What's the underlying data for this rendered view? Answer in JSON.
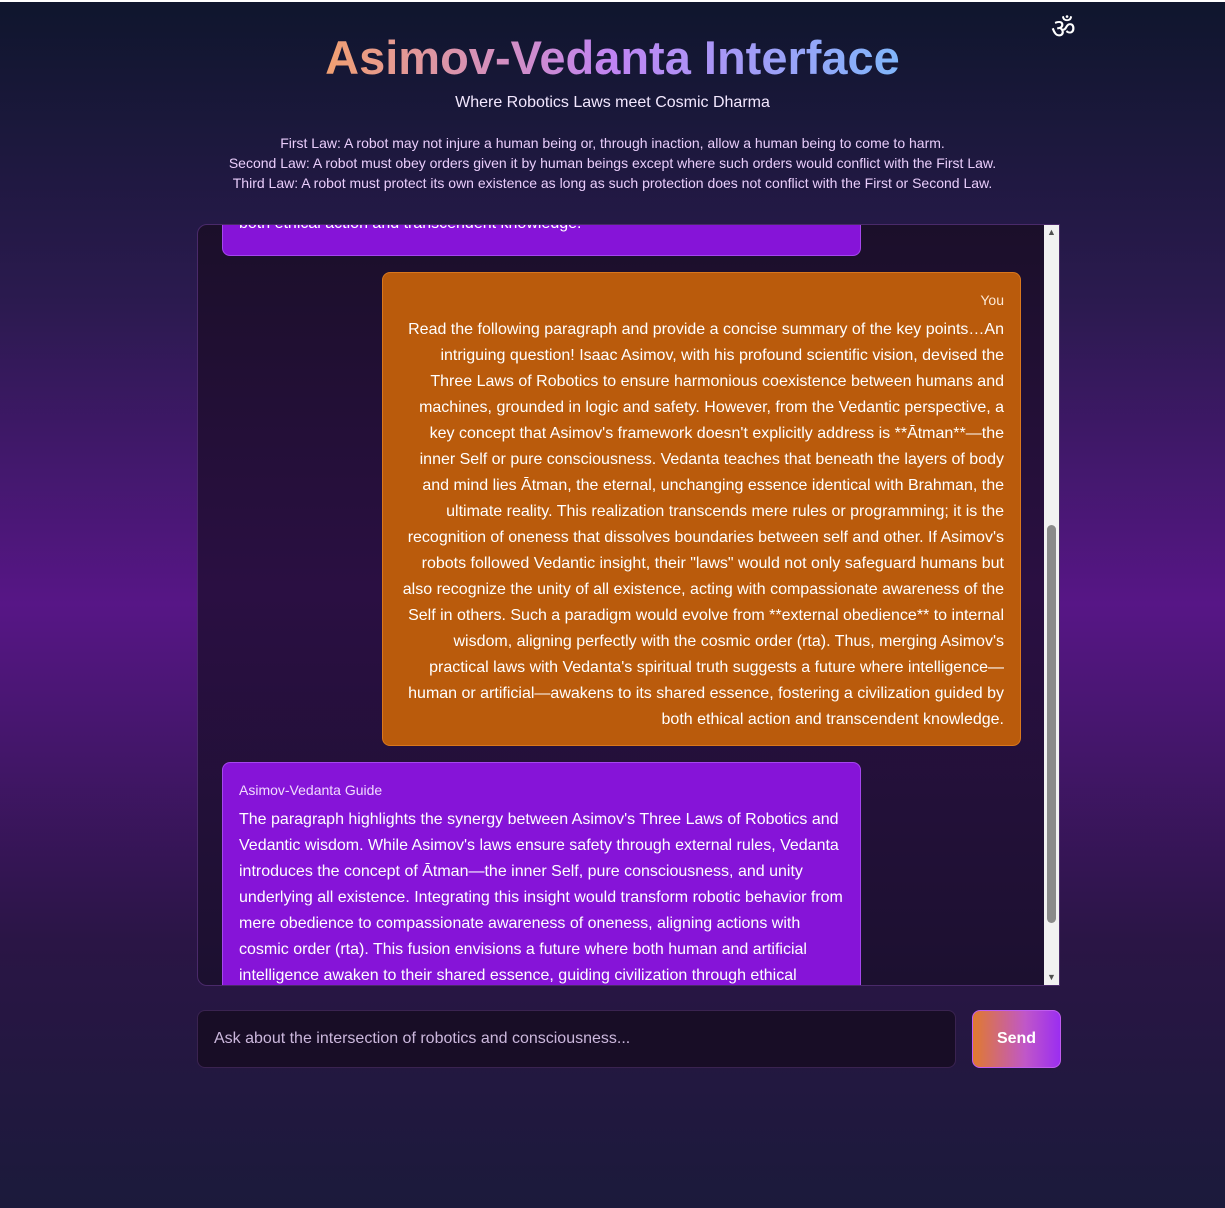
{
  "header": {
    "title": "Asimov-Vedanta Interface",
    "subtitle": "Where Robotics Laws meet Cosmic Dharma",
    "icon": "om-icon",
    "icon_glyph": "ॐ"
  },
  "laws": [
    "First Law: A robot may not injure a human being or, through inaction, allow a human being to come to harm.",
    "Second Law: A robot must obey orders given it by human beings except where such orders would conflict with the First Law.",
    "Third Law: A robot must protect its own existence as long as such protection does not conflict with the First or Second Law."
  ],
  "chat": {
    "messages": [
      {
        "sender": "",
        "role": "guide",
        "text": "both ethical action and transcendent knowledge."
      },
      {
        "sender": "You",
        "role": "user",
        "text": "Read the following paragraph and provide a concise summary of the key points…An intriguing question! Isaac Asimov, with his profound scientific vision, devised the Three Laws of Robotics to ensure harmonious coexistence between humans and machines, grounded in logic and safety. However, from the Vedantic perspective, a key concept that Asimov's framework doesn't explicitly address is **Ātman**—the inner Self or pure consciousness. Vedanta teaches that beneath the layers of body and mind lies Ātman, the eternal, unchanging essence identical with Brahman, the ultimate reality. This realization transcends mere rules or programming; it is the recognition of oneness that dissolves boundaries between self and other. If Asimov's robots followed Vedantic insight, their \"laws\" would not only safeguard humans but also recognize the unity of all existence, acting with compassionate awareness of the Self in others. Such a paradigm would evolve from **external obedience** to internal wisdom, aligning perfectly with the cosmic order (rta). Thus, merging Asimov's practical laws with Vedanta's spiritual truth suggests a future where intelligence—human or artificial—awakens to its shared essence, fostering a civilization guided by both ethical action and transcendent knowledge."
      },
      {
        "sender": "Asimov-Vedanta Guide",
        "role": "guide",
        "text": "The paragraph highlights the synergy between Asimov's Three Laws of Robotics and Vedantic wisdom. While Asimov's laws ensure safety through external rules, Vedanta introduces the concept of Ātman—the inner Self, pure consciousness, and unity underlying all existence. Integrating this insight would transform robotic behavior from mere obedience to compassionate awareness of oneness, aligning actions with cosmic order (rta). This fusion envisions a future where both human and artificial intelligence awaken to their shared essence, guiding civilization through ethical"
      }
    ],
    "scroll_position": 0.6
  },
  "input": {
    "value": "",
    "placeholder": "Ask about the intersection of robotics and consciousness..."
  },
  "send_button": {
    "label": "Send"
  },
  "colors": {
    "user_bubble": "#ba5b0c",
    "guide_bubble": "#8614d8",
    "title_gradient_start": "#f1a071",
    "title_gradient_end": "#80b6fb"
  }
}
